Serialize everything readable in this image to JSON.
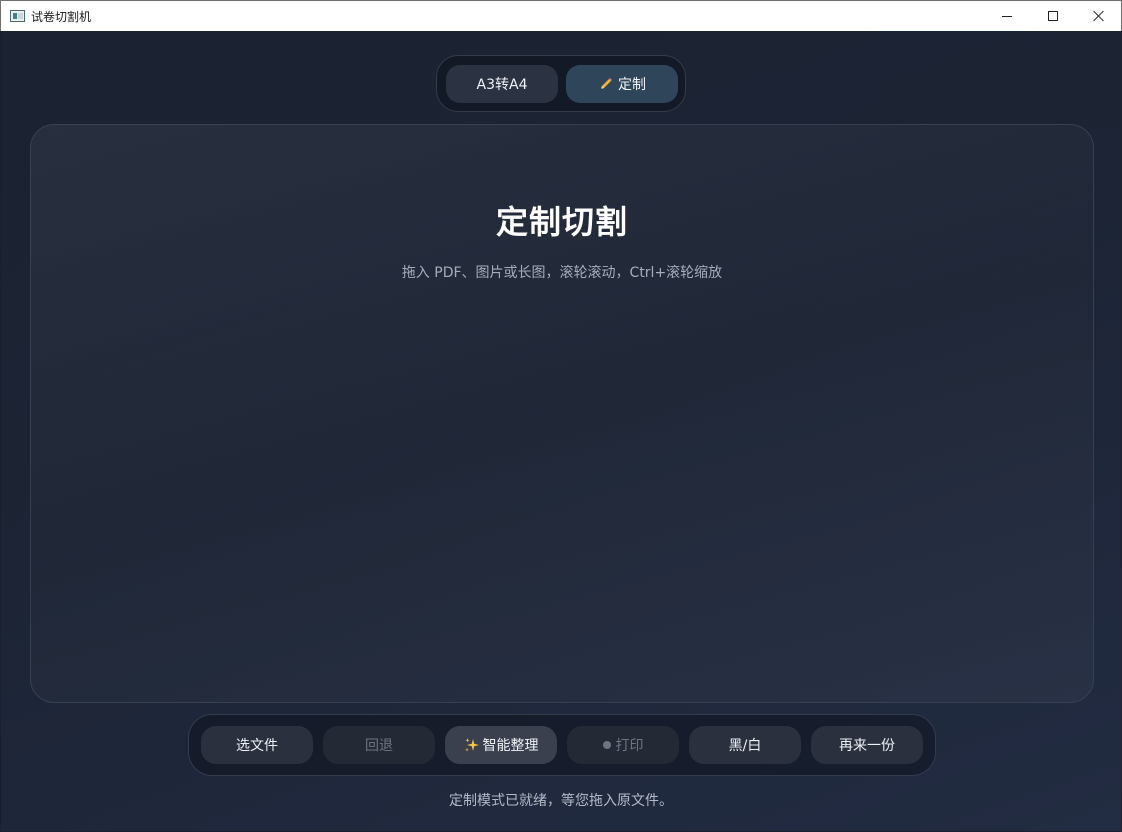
{
  "window": {
    "title": "试卷切割机"
  },
  "mode_switch": {
    "a3_label": "A3转A4",
    "custom_label": "定制",
    "selected": "定制"
  },
  "panel": {
    "title": "定制切割",
    "subtitle": "拖入 PDF、图片或长图，滚轮滚动，Ctrl+滚轮缩放"
  },
  "toolbar": {
    "choose_file": "选文件",
    "undo": "回退",
    "smart_arrange": "智能整理",
    "print": "打印",
    "black_white": "黑/白",
    "another": "再来一份"
  },
  "status": "定制模式已就绪，等您拖入原文件。",
  "colors": {
    "background": "#1c2435",
    "selected_tab": "#2f4559",
    "button": "#2a303d",
    "disabled_text": "#6d7585"
  }
}
